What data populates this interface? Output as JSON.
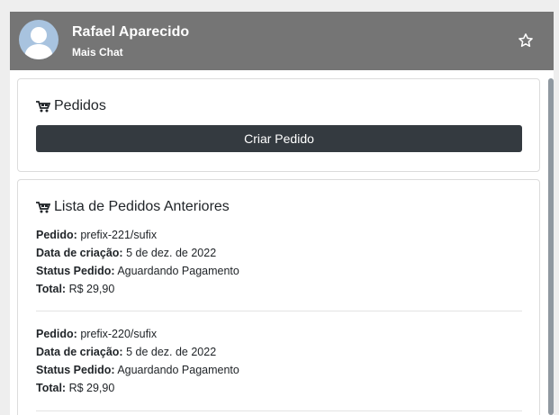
{
  "header": {
    "name": "Rafael Aparecido",
    "subtitle": "Mais Chat",
    "avatar_icon": "user-avatar-icon",
    "favorite_icon": "star-outline-icon"
  },
  "orders_card": {
    "title": "Pedidos",
    "icon": "shopping-cart-icon",
    "create_button": "Criar Pedido"
  },
  "history_card": {
    "title": "Lista de Pedidos Anteriores",
    "icon": "shopping-cart-icon",
    "orders": [
      {
        "order_label": "Pedido:",
        "order_value": "prefix-221/sufix",
        "date_label": "Data de criação:",
        "date_value": "5 de dez. de 2022",
        "status_label": "Status Pedido:",
        "status_value": "Aguardando Pagamento",
        "total_label": "Total:",
        "total_value": "R$ 29,90"
      },
      {
        "order_label": "Pedido:",
        "order_value": "prefix-220/sufix",
        "date_label": "Data de criação:",
        "date_value": "5 de dez. de 2022",
        "status_label": "Status Pedido:",
        "status_value": "Aguardando Pagamento",
        "total_label": "Total:",
        "total_value": "R$ 29,90"
      }
    ]
  },
  "colors": {
    "header_bg": "#757575",
    "button_bg": "#343a40",
    "avatar_bg": "#a8c3df"
  }
}
